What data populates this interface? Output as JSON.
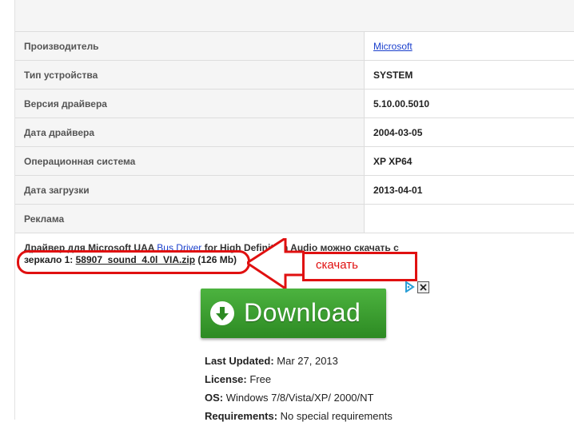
{
  "table": {
    "rows": [
      {
        "label": "Производитель",
        "value": "Microsoft"
      },
      {
        "label": "Тип устройства",
        "value": "SYSTEM"
      },
      {
        "label": "Версия драйвера",
        "value": "5.10.00.5010"
      },
      {
        "label": "Дата драйвера",
        "value": "2004-03-05"
      },
      {
        "label": "Операционная система",
        "value": "XP XP64"
      },
      {
        "label": "Дата загрузки",
        "value": "2013-04-01"
      },
      {
        "label": "Реклама",
        "value": ""
      }
    ]
  },
  "description": {
    "text_before": "Драйвер для Microsoft UAA ",
    "bus_link": "Bus Driver",
    "text_after": " for High Definition Audio можно скачать с",
    "mirror_label": "зеркало 1: ",
    "file_link": "58907_sound_4.0l_VIA.zip",
    "file_size": " (126 Mb)"
  },
  "annotation": {
    "label": "скачать",
    "color": "#e01010"
  },
  "ad": {
    "download_label": "Download",
    "button_color": "#3a9e2f",
    "info": [
      {
        "key": "Last Updated:",
        "value": " Mar 27, 2013"
      },
      {
        "key": "License:",
        "value": " Free"
      },
      {
        "key": "OS:",
        "value": " Windows 7/8/Vista/XP/ 2000/NT"
      },
      {
        "key": "Requirements:",
        "value": " No special requirements"
      }
    ]
  }
}
